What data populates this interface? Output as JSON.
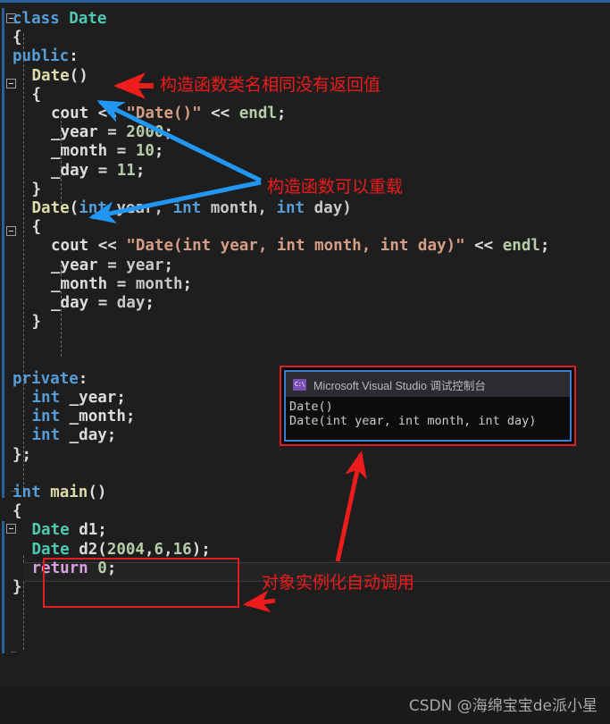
{
  "editor": {
    "theme": "visual-studio-dark",
    "background": "#1e1e1e",
    "accent_blue": "#2a6099",
    "annotation_red": "#ef1b1b",
    "arrow_blue": "#2196f3",
    "code_lines": [
      {
        "n": 1,
        "indent": 0,
        "tokens": [
          {
            "t": "class",
            "c": "kw"
          },
          {
            "t": " ",
            "c": "pln"
          },
          {
            "t": "Date",
            "c": "type"
          }
        ]
      },
      {
        "n": 2,
        "indent": 0,
        "tokens": [
          {
            "t": "{",
            "c": "pln"
          }
        ]
      },
      {
        "n": 3,
        "indent": 0,
        "tokens": [
          {
            "t": "public",
            "c": "kw"
          },
          {
            "t": ":",
            "c": "pln"
          }
        ]
      },
      {
        "n": 4,
        "indent": 1,
        "tokens": [
          {
            "t": "Date",
            "c": "fn"
          },
          {
            "t": "()",
            "c": "pln"
          }
        ]
      },
      {
        "n": 5,
        "indent": 1,
        "tokens": [
          {
            "t": "{",
            "c": "pln"
          }
        ]
      },
      {
        "n": 6,
        "indent": 2,
        "tokens": [
          {
            "t": "cout",
            "c": "pln"
          },
          {
            "t": " << ",
            "c": "op"
          },
          {
            "t": "\"Date()\"",
            "c": "str"
          },
          {
            "t": " << ",
            "c": "op"
          },
          {
            "t": "endl",
            "c": "num"
          },
          {
            "t": ";",
            "c": "pln"
          }
        ]
      },
      {
        "n": 7,
        "indent": 2,
        "tokens": [
          {
            "t": "_year",
            "c": "pln"
          },
          {
            "t": " = ",
            "c": "op"
          },
          {
            "t": "2000",
            "c": "num"
          },
          {
            "t": ";",
            "c": "pln"
          }
        ]
      },
      {
        "n": 8,
        "indent": 2,
        "tokens": [
          {
            "t": "_month",
            "c": "pln"
          },
          {
            "t": " = ",
            "c": "op"
          },
          {
            "t": "10",
            "c": "num"
          },
          {
            "t": ";",
            "c": "pln"
          }
        ]
      },
      {
        "n": 9,
        "indent": 2,
        "tokens": [
          {
            "t": "_day",
            "c": "pln"
          },
          {
            "t": " = ",
            "c": "op"
          },
          {
            "t": "11",
            "c": "num"
          },
          {
            "t": ";",
            "c": "pln"
          }
        ]
      },
      {
        "n": 10,
        "indent": 1,
        "tokens": [
          {
            "t": "}",
            "c": "pln"
          }
        ]
      },
      {
        "n": 11,
        "indent": 1,
        "tokens": [
          {
            "t": "Date",
            "c": "fn"
          },
          {
            "t": "(",
            "c": "pln"
          },
          {
            "t": "int",
            "c": "kw"
          },
          {
            "t": " year, ",
            "c": "prm"
          },
          {
            "t": "int",
            "c": "kw"
          },
          {
            "t": " month, ",
            "c": "prm"
          },
          {
            "t": "int",
            "c": "kw"
          },
          {
            "t": " day)",
            "c": "prm"
          }
        ]
      },
      {
        "n": 12,
        "indent": 1,
        "tokens": [
          {
            "t": "{",
            "c": "pln"
          }
        ]
      },
      {
        "n": 13,
        "indent": 2,
        "tokens": [
          {
            "t": "cout",
            "c": "pln"
          },
          {
            "t": " << ",
            "c": "op"
          },
          {
            "t": "\"Date(int year, int month, int day)\"",
            "c": "str"
          },
          {
            "t": " << ",
            "c": "op"
          },
          {
            "t": "endl",
            "c": "num"
          },
          {
            "t": ";",
            "c": "pln"
          }
        ]
      },
      {
        "n": 14,
        "indent": 2,
        "tokens": [
          {
            "t": "_year",
            "c": "pln"
          },
          {
            "t": " = ",
            "c": "op"
          },
          {
            "t": "year",
            "c": "prm"
          },
          {
            "t": ";",
            "c": "pln"
          }
        ]
      },
      {
        "n": 15,
        "indent": 2,
        "tokens": [
          {
            "t": "_month",
            "c": "pln"
          },
          {
            "t": " = ",
            "c": "op"
          },
          {
            "t": "month",
            "c": "prm"
          },
          {
            "t": ";",
            "c": "pln"
          }
        ]
      },
      {
        "n": 16,
        "indent": 2,
        "tokens": [
          {
            "t": "_day",
            "c": "pln"
          },
          {
            "t": " = ",
            "c": "op"
          },
          {
            "t": "day",
            "c": "prm"
          },
          {
            "t": ";",
            "c": "pln"
          }
        ]
      },
      {
        "n": 17,
        "indent": 1,
        "tokens": [
          {
            "t": "}",
            "c": "pln"
          }
        ]
      },
      {
        "n": 18,
        "indent": 0,
        "tokens": []
      },
      {
        "n": 19,
        "indent": 0,
        "tokens": []
      },
      {
        "n": 20,
        "indent": 0,
        "tokens": [
          {
            "t": "private",
            "c": "kw"
          },
          {
            "t": ":",
            "c": "pln"
          }
        ]
      },
      {
        "n": 21,
        "indent": 1,
        "tokens": [
          {
            "t": "int",
            "c": "kw"
          },
          {
            "t": " _year;",
            "c": "pln"
          }
        ]
      },
      {
        "n": 22,
        "indent": 1,
        "tokens": [
          {
            "t": "int",
            "c": "kw"
          },
          {
            "t": " _month;",
            "c": "pln"
          }
        ]
      },
      {
        "n": 23,
        "indent": 1,
        "tokens": [
          {
            "t": "int",
            "c": "kw"
          },
          {
            "t": " _day;",
            "c": "pln"
          }
        ]
      },
      {
        "n": 24,
        "indent": 0,
        "tokens": [
          {
            "t": "};",
            "c": "pln"
          }
        ]
      },
      {
        "n": 25,
        "indent": 0,
        "tokens": []
      },
      {
        "n": 26,
        "indent": 0,
        "tokens": [
          {
            "t": "int",
            "c": "kw"
          },
          {
            "t": " ",
            "c": "pln"
          },
          {
            "t": "main",
            "c": "fn"
          },
          {
            "t": "()",
            "c": "pln"
          }
        ]
      },
      {
        "n": 27,
        "indent": 0,
        "tokens": [
          {
            "t": "{",
            "c": "pln"
          }
        ]
      },
      {
        "n": 28,
        "indent": 1,
        "tokens": [
          {
            "t": "Date",
            "c": "type"
          },
          {
            "t": " d1;",
            "c": "pln"
          }
        ]
      },
      {
        "n": 29,
        "indent": 1,
        "tokens": [
          {
            "t": "Date",
            "c": "type"
          },
          {
            "t": " d2(",
            "c": "pln"
          },
          {
            "t": "2004",
            "c": "num"
          },
          {
            "t": ",",
            "c": "pln"
          },
          {
            "t": "6",
            "c": "num"
          },
          {
            "t": ",",
            "c": "pln"
          },
          {
            "t": "16",
            "c": "num"
          },
          {
            "t": ");",
            "c": "pln"
          }
        ]
      },
      {
        "n": 30,
        "indent": 1,
        "tokens": [
          {
            "t": "return",
            "c": "ret"
          },
          {
            "t": " ",
            "c": "pln"
          },
          {
            "t": "0",
            "c": "num"
          },
          {
            "t": ";",
            "c": "pln"
          }
        ]
      },
      {
        "n": 31,
        "indent": 0,
        "tokens": [
          {
            "t": "}",
            "c": "pln"
          }
        ]
      }
    ]
  },
  "console_window": {
    "title": "Microsoft Visual Studio 调试控制台",
    "icon": "console-cmd-icon",
    "icon_text": "C:\\",
    "output_lines": [
      "Date()",
      "Date(int year, int month, int day)"
    ]
  },
  "annotations": [
    {
      "id": "ann-ctor-name",
      "text": "构造函数类名相同没有返回值"
    },
    {
      "id": "ann-ctor-overload",
      "text": "构造函数可以重载"
    },
    {
      "id": "ann-auto-call",
      "text": "对象实例化自动调用"
    }
  ],
  "watermark": {
    "text": "CSDN @海绵宝宝de派小星"
  }
}
